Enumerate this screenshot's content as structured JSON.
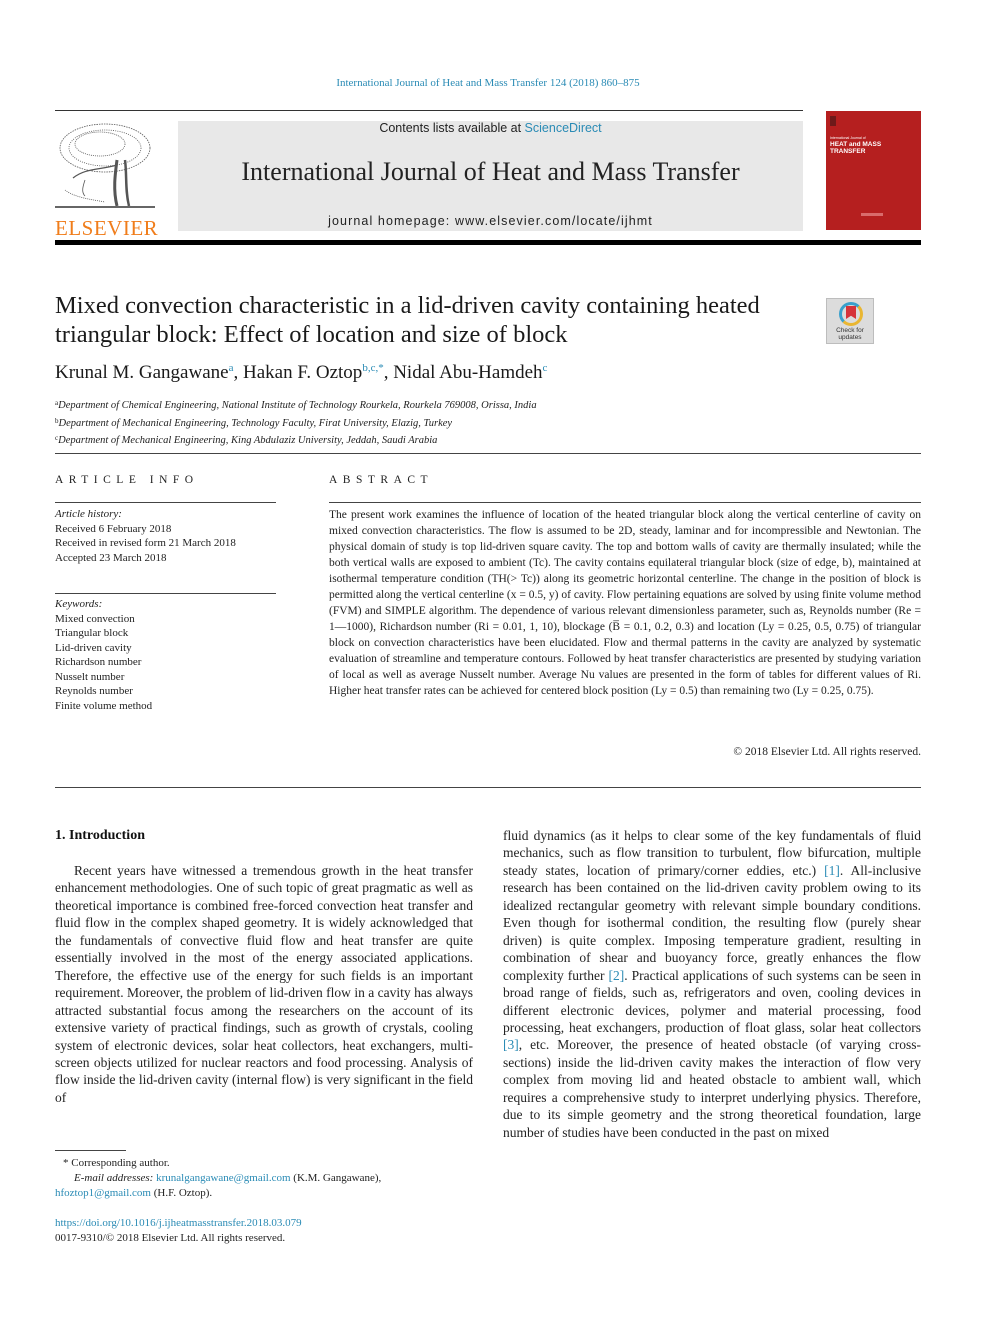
{
  "journal_citation": "International Journal of Heat and Mass Transfer 124 (2018) 860–875",
  "header": {
    "publisher_logo_text": "ELSEVIER",
    "contents_prefix": "Contents lists available at ",
    "contents_link": "ScienceDirect",
    "journal_title": "International Journal of Heat and Mass Transfer",
    "homepage": "journal homepage: www.elsevier.com/locate/ijhmt",
    "cover": {
      "small_text": "International Journal of",
      "big_text_line1": "HEAT and MASS",
      "big_text_line2": "TRANSFER",
      "color": "#b51f1f"
    },
    "accent_color": "#2a8bb5",
    "logo_color": "#f07d1b"
  },
  "article": {
    "title": "Mixed convection characteristic in a lid-driven cavity containing heated triangular block: Effect of location and size of block",
    "check_updates_label": [
      "Check for",
      "updates"
    ],
    "authors": [
      {
        "name": "Krunal M. Gangawane",
        "sup": "a"
      },
      {
        "name": "Hakan F. Oztop",
        "sup": "b,c,*"
      },
      {
        "name": "Nidal Abu-Hamdeh",
        "sup": "c"
      }
    ],
    "affiliations": [
      {
        "key": "a",
        "text": "Department of Chemical Engineering, National Institute of Technology Rourkela, Rourkela 769008, Orissa, India"
      },
      {
        "key": "b",
        "text": "Department of Mechanical Engineering, Technology Faculty, Firat University, Elazig, Turkey"
      },
      {
        "key": "c",
        "text": "Department of Mechanical Engineering, King Abdulaziz University, Jeddah, Saudi Arabia"
      }
    ]
  },
  "article_info": {
    "heading": "ARTICLE INFO",
    "history_label": "Article history:",
    "history": [
      "Received 6 February 2018",
      "Received in revised form 21 March 2018",
      "Accepted 23 March 2018"
    ],
    "keywords_label": "Keywords:",
    "keywords": [
      "Mixed convection",
      "Triangular block",
      "Lid-driven cavity",
      "Richardson number",
      "Nusselt number",
      "Reynolds number",
      "Finite volume method"
    ]
  },
  "abstract": {
    "heading": "ABSTRACT",
    "text": "The present work examines the influence of location of the heated triangular block along the vertical centerline of cavity on mixed convection characteristics. The flow is assumed to be 2D, steady, laminar and for incompressible and Newtonian. The physical domain of study is top lid-driven square cavity. The top and bottom walls of cavity are thermally insulated; while the both vertical walls are exposed to ambient (Tc). The cavity contains equilateral triangular block (size of edge, b), maintained at isothermal temperature condition (TH(> Tc)) along its geometric horizontal centerline. The change in the position of block is permitted along the vertical centerline (x = 0.5, y) of cavity. Flow pertaining equations are solved by using finite volume method (FVM) and SIMPLE algorithm. The dependence of various relevant dimensionless parameter, such as, Reynolds number (Re = 1—1000), Richardson number (Ri = 0.01, 1, 10), blockage (B̅ = 0.1, 0.2, 0.3) and location (Ly = 0.25, 0.5, 0.75) of triangular block on convection characteristics have been elucidated. Flow and thermal patterns in the cavity are analyzed by systematic evaluation of streamline and temperature contours. Followed by heat transfer characteristics are presented by studying variation of local as well as average Nusselt number. Average Nu values are presented in the form of tables for different values of Ri. Higher heat transfer rates can be achieved for centered block position (Ly = 0.5) than remaining two (Ly = 0.25, 0.75).",
    "copyright": "© 2018 Elsevier Ltd. All rights reserved."
  },
  "introduction": {
    "heading": "1. Introduction",
    "left_column": "Recent years have witnessed a tremendous growth in the heat transfer enhancement methodologies. One of such topic of great pragmatic as well as theoretical importance is combined free-forced convection heat transfer and fluid flow in the complex shaped geometry. It is widely acknowledged that the fundamentals of convective fluid flow and heat transfer are quite essentially involved in the most of the energy associated applications. Therefore, the effective use of the energy for such fields is an important requirement. Moreover, the problem of lid-driven flow in a cavity has always attracted substantial focus among the researchers on the account of its extensive variety of practical findings, such as growth of crystals, cooling system of electronic devices, solar heat collectors, heat exchangers, multi-screen objects utilized for nuclear reactors and food processing. Analysis of flow inside the lid-driven cavity (internal flow) is very significant in the field of",
    "right_column_parts": [
      {
        "text": "fluid dynamics (as it helps to clear some of the key fundamentals of fluid mechanics, such as flow transition to turbulent, flow bifurcation, multiple steady states, location of primary/corner eddies, etc.) "
      },
      {
        "ref": "[1]"
      },
      {
        "text": ". All-inclusive research has been contained on the lid-driven cavity problem owing to its idealized rectangular geometry with relevant simple boundary conditions. Even though for isothermal condition, the resulting flow (purely shear driven) is quite complex. Imposing temperature gradient, resulting in combination of shear and buoyancy force, greatly enhances the flow complexity further "
      },
      {
        "ref": "[2]"
      },
      {
        "text": ". Practical applications of such systems can be seen in broad range of fields, such as, refrigerators and oven, cooling devices in different electronic devices, polymer and material processing, food processing, heat exchangers, production of float glass, solar heat collectors "
      },
      {
        "ref": "[3]"
      },
      {
        "text": ", etc. Moreover, the presence of heated obstacle (of varying cross-sections) inside the lid-driven cavity makes the interaction of flow very complex from moving lid and heated obstacle to ambient wall, which requires a comprehensive study to interpret underlying physics. Therefore, due to its simple geometry and the strong theoretical foundation, large number of studies have been conducted in the past on mixed"
      }
    ]
  },
  "footnotes": {
    "corresponding": "* Corresponding author.",
    "email_label": "E-mail addresses:",
    "email1": "krunalgangawane@gmail.com",
    "email1_owner": " (K.M. Gangawane), ",
    "email2": "hfoztop1@gmail.com",
    "email2_owner": " (H.F. Oztop).",
    "doi": "https://doi.org/10.1016/j.ijheatmasstransfer.2018.03.079",
    "issn": "0017-9310/© 2018 Elsevier Ltd. All rights reserved."
  }
}
